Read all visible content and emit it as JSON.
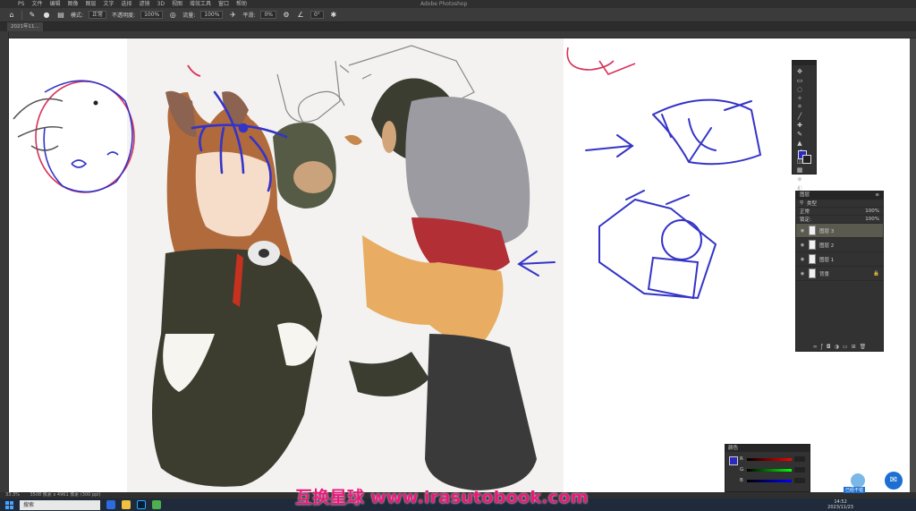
{
  "app": {
    "menu": [
      "PS",
      "文件",
      "编辑",
      "图像",
      "图层",
      "文字",
      "选择",
      "滤镜",
      "3D",
      "视图",
      "增效工具",
      "窗口",
      "帮助"
    ],
    "center_title": "Adobe Photoshop"
  },
  "options": {
    "mode_label": "模式:",
    "mode_value": "正常",
    "opacity_label": "不透明度:",
    "opacity_value": "100%",
    "flow_label": "流量:",
    "flow_value": "100%",
    "smooth_label": "平滑:",
    "smooth_value": "0%",
    "angle_value": "0°"
  },
  "document_tab": "2021年11...",
  "layers": {
    "title": "图层",
    "kind_label": "类型",
    "blend_label": "正常",
    "opacity_value": "100%",
    "lock_label": "锁定:",
    "fill_value": "100%",
    "rows": [
      {
        "name": "图层 3",
        "active": true
      },
      {
        "name": "图层 2",
        "active": false
      },
      {
        "name": "图层 1",
        "active": false
      },
      {
        "name": "背景",
        "active": false
      }
    ]
  },
  "color_panel": {
    "title": "颜色",
    "values": [
      "R",
      "G",
      "B"
    ]
  },
  "colors": {
    "foreground": "#2a2bbd",
    "background": "#222222",
    "sketch_blue": "#3434c8",
    "sketch_red": "#d8325a"
  },
  "status": {
    "zoom": "33.3%",
    "doc_info": "3508 像素 x 4961 像素 (300 ppi)"
  },
  "taskbar": {
    "search_placeholder": "搜索",
    "time": "14:52",
    "date": "2023/11/23"
  },
  "watermark": "互换星球 www.irasutobook.com",
  "avatar_label": "已经不错"
}
